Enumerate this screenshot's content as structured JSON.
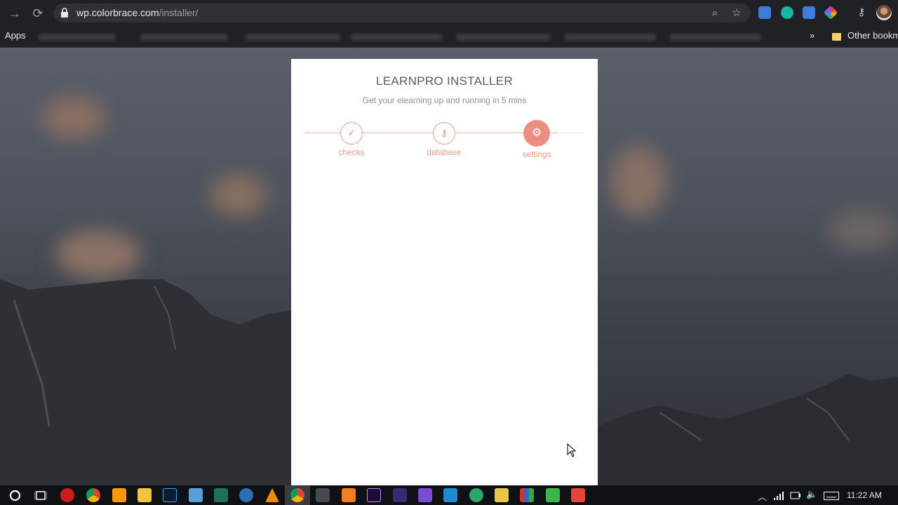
{
  "browser": {
    "url_host": "wp.colorbrace.com",
    "url_path": "/installer/",
    "bookmarks": {
      "apps_label": "Apps",
      "overflow_label": "»",
      "other_label": "Other bookma"
    },
    "icons": [
      "back-arrow-icon",
      "reload-icon",
      "lock-icon",
      "zoom-icon",
      "star-icon",
      "key-icon"
    ]
  },
  "installer": {
    "title": "LEARNPRO INSTALLER",
    "subtitle": "Get your elearning up and running in 5 mins",
    "steps": [
      {
        "label": "checks",
        "icon": "check-icon",
        "glyph": "✓"
      },
      {
        "label": "database",
        "icon": "key-icon",
        "glyph": "⚷"
      },
      {
        "label": "settings",
        "icon": "gear-icon",
        "glyph": "⚙"
      }
    ],
    "active_step": "settings",
    "accent_color": "#ec8f81"
  },
  "taskbar": {
    "time": "11:22 AM"
  }
}
